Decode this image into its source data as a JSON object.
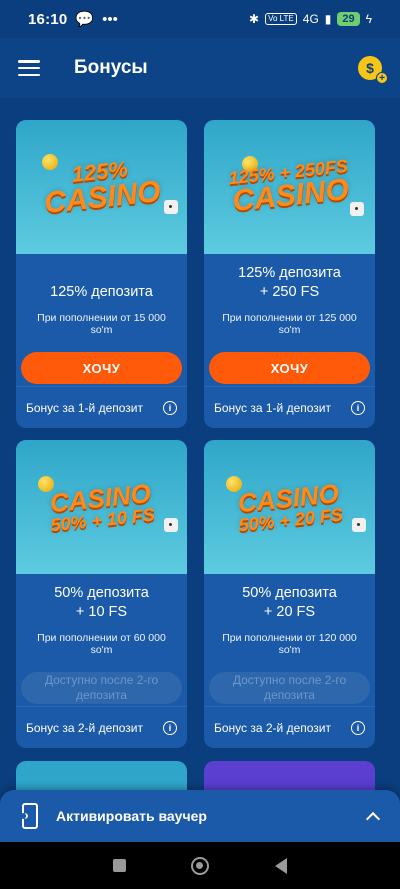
{
  "status": {
    "time": "16:10",
    "battery": "29",
    "network": "4G",
    "volte": "Vo LTE"
  },
  "header": {
    "title": "Бонусы"
  },
  "cards": [
    {
      "banner_line1": "125%",
      "banner_line2": "CASINO",
      "title": "125% депозита",
      "subtitle": "При пополнении от 15 000 so'm",
      "button": "ХОЧУ",
      "button_enabled": true,
      "footer": "Бонус за 1-й депозит"
    },
    {
      "banner_line1": "125% + 250FS",
      "banner_line2": "CASINO",
      "title": "125% депозита\n+ 250 FS",
      "subtitle": "При пополнении от 125 000 so'm",
      "button": "ХОЧУ",
      "button_enabled": true,
      "footer": "Бонус за 1-й депозит"
    },
    {
      "banner_line1": "CASINO",
      "banner_line2": "50% + 10 FS",
      "title": "50% депозита\n+ 10 FS",
      "subtitle": "При пополнении от 60 000 so'm",
      "button": "Доступно после 2-го депозита",
      "button_enabled": false,
      "footer": "Бонус за 2-й депозит"
    },
    {
      "banner_line1": "CASINO",
      "banner_line2": "50% + 20 FS",
      "title": "50% депозита\n+ 20 FS",
      "subtitle": "При пополнении от 120 000 so'm",
      "button": "Доступно после 2-го депозита",
      "button_enabled": false,
      "footer": "Бонус за 2-й депозит"
    }
  ],
  "voucher": {
    "label": "Активировать ваучер"
  },
  "colors": {
    "background": "#0b3e7e",
    "card": "#1b5aa8",
    "accent": "#ff5a0a",
    "coin": "#f5c518"
  },
  "icons": {
    "menu": "hamburger-icon",
    "coin": "dollar-coin-plus-icon",
    "info": "info-icon",
    "voucher": "ticket-icon",
    "expand": "chevron-up-icon"
  }
}
